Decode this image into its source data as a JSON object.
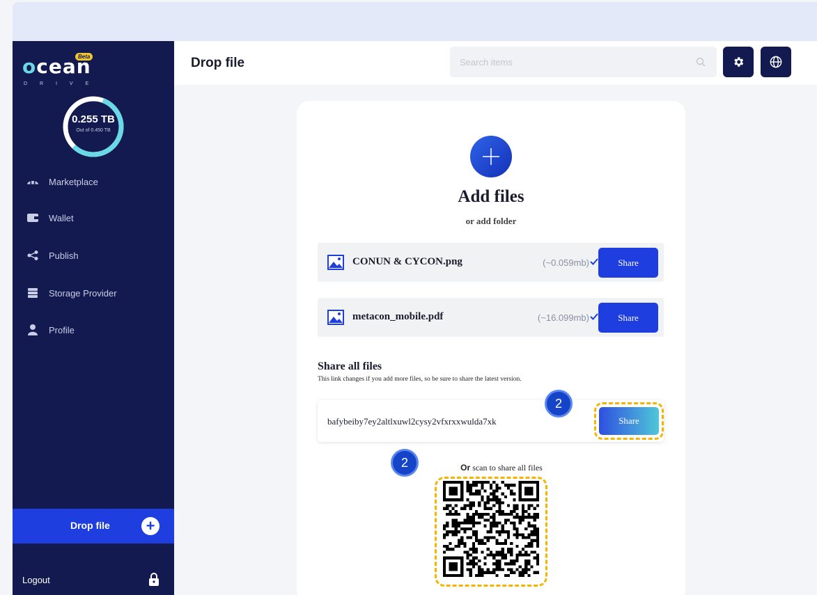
{
  "app": {
    "logo_text": "ocean",
    "logo_sub": "D R I V E",
    "beta": "Beta"
  },
  "storage": {
    "used": "0.255 TB",
    "total": "Out of 0.450 TB",
    "used_fraction": 0.567
  },
  "sidebar": {
    "items": [
      {
        "label": "Marketplace",
        "icon": "marketplace-icon"
      },
      {
        "label": "Wallet",
        "icon": "wallet-icon"
      },
      {
        "label": "Publish",
        "icon": "share-nodes-icon"
      },
      {
        "label": "Storage Provider",
        "icon": "server-icon"
      },
      {
        "label": "Profile",
        "icon": "user-icon"
      }
    ],
    "drop_label": "Drop file",
    "logout_label": "Logout"
  },
  "header": {
    "title": "Drop file",
    "search_placeholder": "Search items"
  },
  "upload": {
    "title": "Add files",
    "subtitle": "or add folder"
  },
  "files": [
    {
      "name": "CONUN & CYCON.png",
      "size": "(~0.059mb)",
      "share_label": "Share"
    },
    {
      "name": "metacon_mobile.pdf",
      "size": "(~16.099mb)",
      "share_label": "Share"
    }
  ],
  "share_all": {
    "title": "Share all files",
    "description": "This link changes if you add more files, so be sure to share the latest version.",
    "link": "bafybeiby7ey2altlxuwl2cysy2vfxrxxwulda7xk",
    "share_label": "Share",
    "scan_or": "Or",
    "scan_text": " scan to share all files"
  },
  "annotations": {
    "badge_1": "2",
    "badge_2": "2"
  },
  "colors": {
    "sidebar": "#131a4f",
    "accent": "#1f3ee0",
    "highlight": "#f5b400",
    "teal": "#6ad9e6"
  }
}
